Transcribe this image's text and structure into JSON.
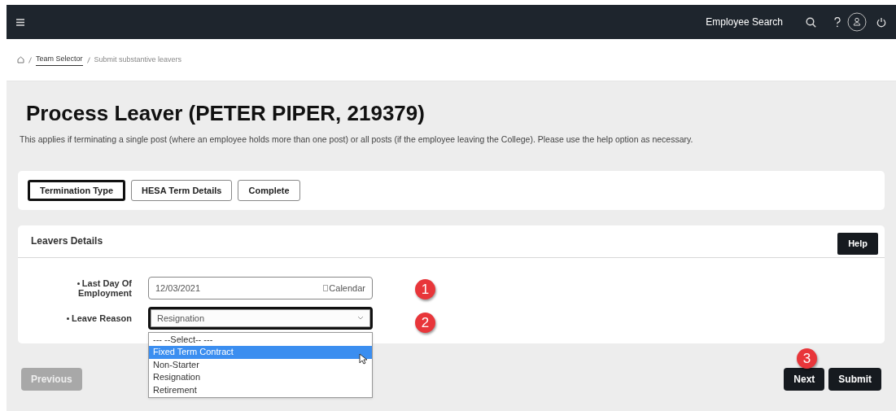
{
  "nav": {
    "search_label": "Employee Search"
  },
  "breadcrumb": [
    {
      "label": "Team Selector",
      "link": true
    },
    {
      "label": "Submit substantive leavers",
      "link": false
    }
  ],
  "title": "Process Leaver (PETER PIPER, 219379)",
  "description": "This applies if terminating a single post (where an employee holds more than one post) or all posts (if the employee leaving the College). Please use the help option as necessary.",
  "steps": [
    {
      "label": "Termination Type",
      "selected": true
    },
    {
      "label": "HESA Term Details",
      "selected": false
    },
    {
      "label": "Complete",
      "selected": false
    }
  ],
  "section": {
    "title": "Leavers Details",
    "help_button": "Help"
  },
  "fields": [
    {
      "kind": "date",
      "label": "Last Day Of Employment",
      "required": true,
      "value": "12/03/2021",
      "icon_alt": "Calendar",
      "focused": false
    },
    {
      "kind": "select",
      "label": "Leave Reason",
      "required": true,
      "value": "Resignation",
      "focused": true,
      "expanded": true,
      "options": [
        {
          "label": "--- --Select-- ---",
          "highlighted": false
        },
        {
          "label": "Fixed Term Contract",
          "highlighted": true
        },
        {
          "label": "Non-Starter",
          "highlighted": false
        },
        {
          "label": "Resignation",
          "highlighted": false
        },
        {
          "label": "Retirement",
          "highlighted": false
        }
      ]
    }
  ],
  "markers": [
    "1",
    "2",
    "3"
  ],
  "buttons": {
    "previous": {
      "label": "Previous",
      "disabled": true
    },
    "next": {
      "label": "Next",
      "disabled": false
    },
    "submit": {
      "label": "Submit",
      "disabled": false
    }
  }
}
